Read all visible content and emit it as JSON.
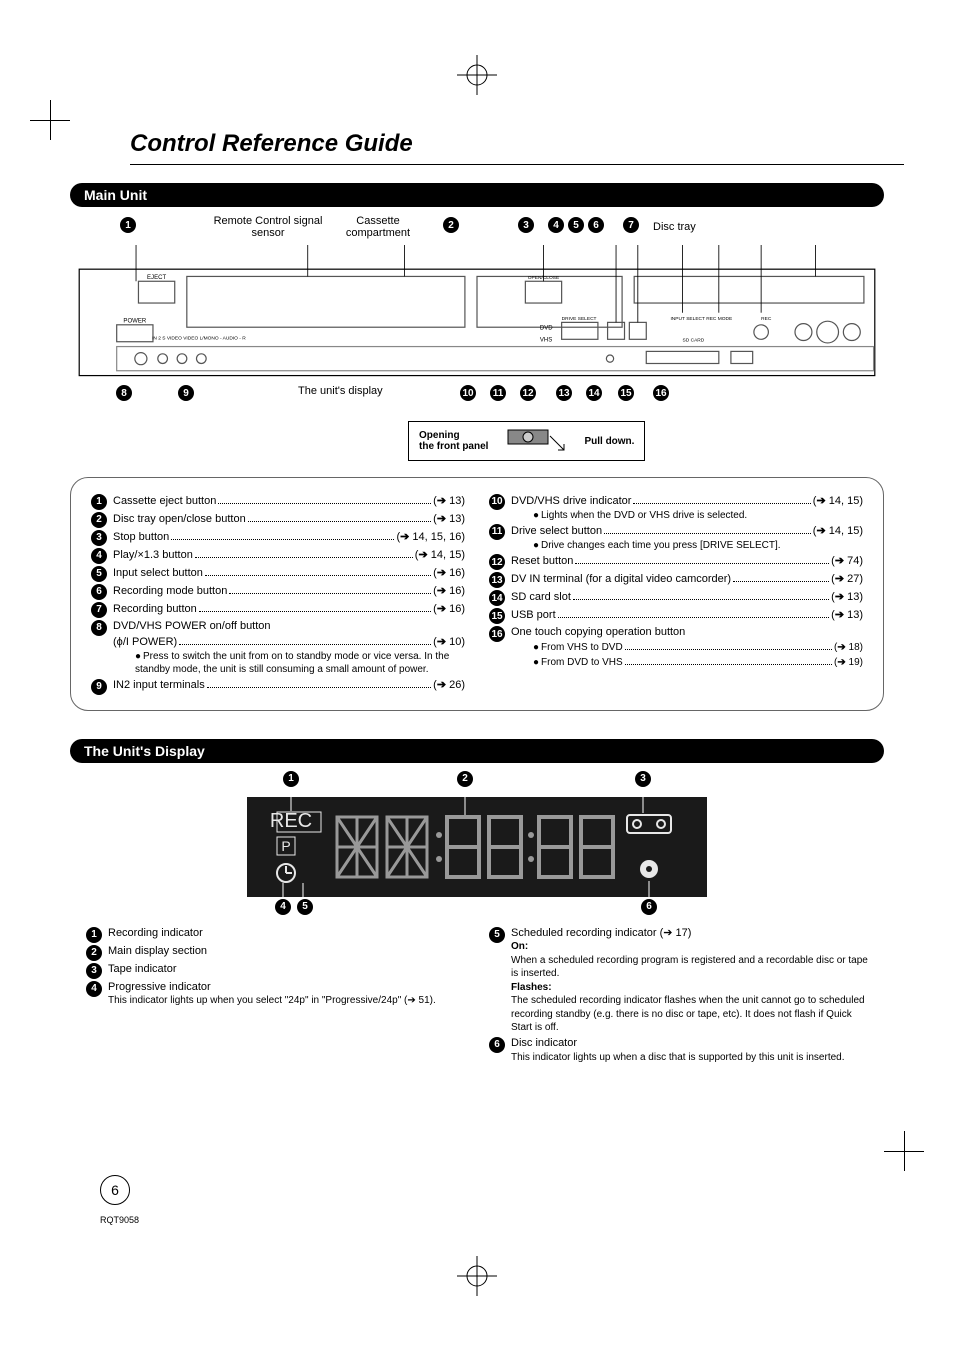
{
  "title": "Control Reference Guide",
  "page_number": "6",
  "doc_id": "RQT9058",
  "main_unit": {
    "header": "Main Unit",
    "labels": {
      "remote_sensor": "Remote Control signal sensor",
      "cassette": "Cassette compartment",
      "disc_tray": "Disc tray",
      "unit_display": "The unit's display"
    },
    "diagram_text": {
      "eject": "EJECT",
      "power": "POWER",
      "open_close": "OPEN/CLOSE",
      "drive_select": "DRIVE SELECT",
      "dvd": "DVD",
      "vhs": "VHS",
      "sd_card": "SD CARD",
      "rec": "REC",
      "input_select": "INPUT SELECT  REC MODE",
      "in2": "IN 2   S VIDEO  VIDEO        L/MONO - AUDIO - R"
    },
    "front_panel": {
      "opening": "Opening",
      "the_panel": "the front panel",
      "pull": "Pull down."
    },
    "callouts_top": [
      "1",
      "2",
      "3",
      "4",
      "5",
      "6",
      "7"
    ],
    "callouts_bottom": [
      "8",
      "9",
      "10",
      "11",
      "12",
      "13",
      "14",
      "15",
      "16"
    ],
    "legend_left": [
      {
        "n": "1",
        "t": "Cassette eject button",
        "r": "13"
      },
      {
        "n": "2",
        "t": "Disc tray open/close button",
        "r": "13"
      },
      {
        "n": "3",
        "t": "Stop button",
        "r": "14, 15, 16"
      },
      {
        "n": "4",
        "t": "Play/×1.3 button",
        "r": "14, 15"
      },
      {
        "n": "5",
        "t": "Input select button",
        "r": "16"
      },
      {
        "n": "6",
        "t": "Recording mode button",
        "r": "16"
      },
      {
        "n": "7",
        "t": "Recording button",
        "r": "16"
      },
      {
        "n": "8",
        "t": "DVD/VHS POWER on/off button",
        "sub_plain": "(ϕ/I POWER)",
        "sub_ref": "10",
        "notes": [
          "Press to switch the unit from on to standby mode or vice versa. In the standby mode, the unit is still consuming a small amount of power."
        ]
      },
      {
        "n": "9",
        "t": "IN2 input terminals",
        "r": "26"
      }
    ],
    "legend_right": [
      {
        "n": "10",
        "t": "DVD/VHS drive indicator",
        "r": "14, 15",
        "notes": [
          "Lights when the DVD or VHS drive is selected."
        ]
      },
      {
        "n": "11",
        "t": "Drive select button",
        "r": "14, 15",
        "notes": [
          "Drive changes each time you press [DRIVE SELECT]."
        ]
      },
      {
        "n": "12",
        "t": "Reset button",
        "r": "74"
      },
      {
        "n": "13",
        "t": "DV IN terminal (for a digital video camcorder)",
        "r": "27"
      },
      {
        "n": "14",
        "t": "SD card slot",
        "r": "13"
      },
      {
        "n": "15",
        "t": "USB port",
        "r": "13"
      },
      {
        "n": "16",
        "t": "One touch copying operation button",
        "sub_refs": [
          {
            "t": "From VHS to DVD",
            "r": "18"
          },
          {
            "t": "From DVD to VHS",
            "r": "19"
          }
        ]
      }
    ]
  },
  "display": {
    "header": "The Unit's Display",
    "indicators": {
      "rec": "REC",
      "p": "P"
    },
    "callouts_top": [
      "1",
      "2",
      "3"
    ],
    "callouts_bottom": [
      "4",
      "5",
      "6"
    ],
    "legend_left": [
      {
        "n": "1",
        "t": "Recording indicator"
      },
      {
        "n": "2",
        "t": "Main display section"
      },
      {
        "n": "3",
        "t": "Tape indicator"
      },
      {
        "n": "4",
        "t": "Progressive indicator",
        "notes": [
          "This indicator lights up when you select \"24p\" in \"Progressive/24p\" (➔ 51)."
        ]
      }
    ],
    "legend_right": [
      {
        "n": "5",
        "t": "Scheduled recording indicator (➔ 17)",
        "rich": [
          {
            "b": "On:",
            "p": "When a scheduled recording program is registered and a recordable disc or tape is inserted."
          },
          {
            "b": "Flashes:",
            "p": "The scheduled recording indicator flashes when the unit cannot go to scheduled recording standby (e.g. there is no disc or tape, etc). It does not flash if Quick Start is off."
          }
        ]
      },
      {
        "n": "6",
        "t": "Disc indicator",
        "notes": [
          "This indicator lights up when a disc that is supported by this unit is inserted."
        ]
      }
    ]
  }
}
